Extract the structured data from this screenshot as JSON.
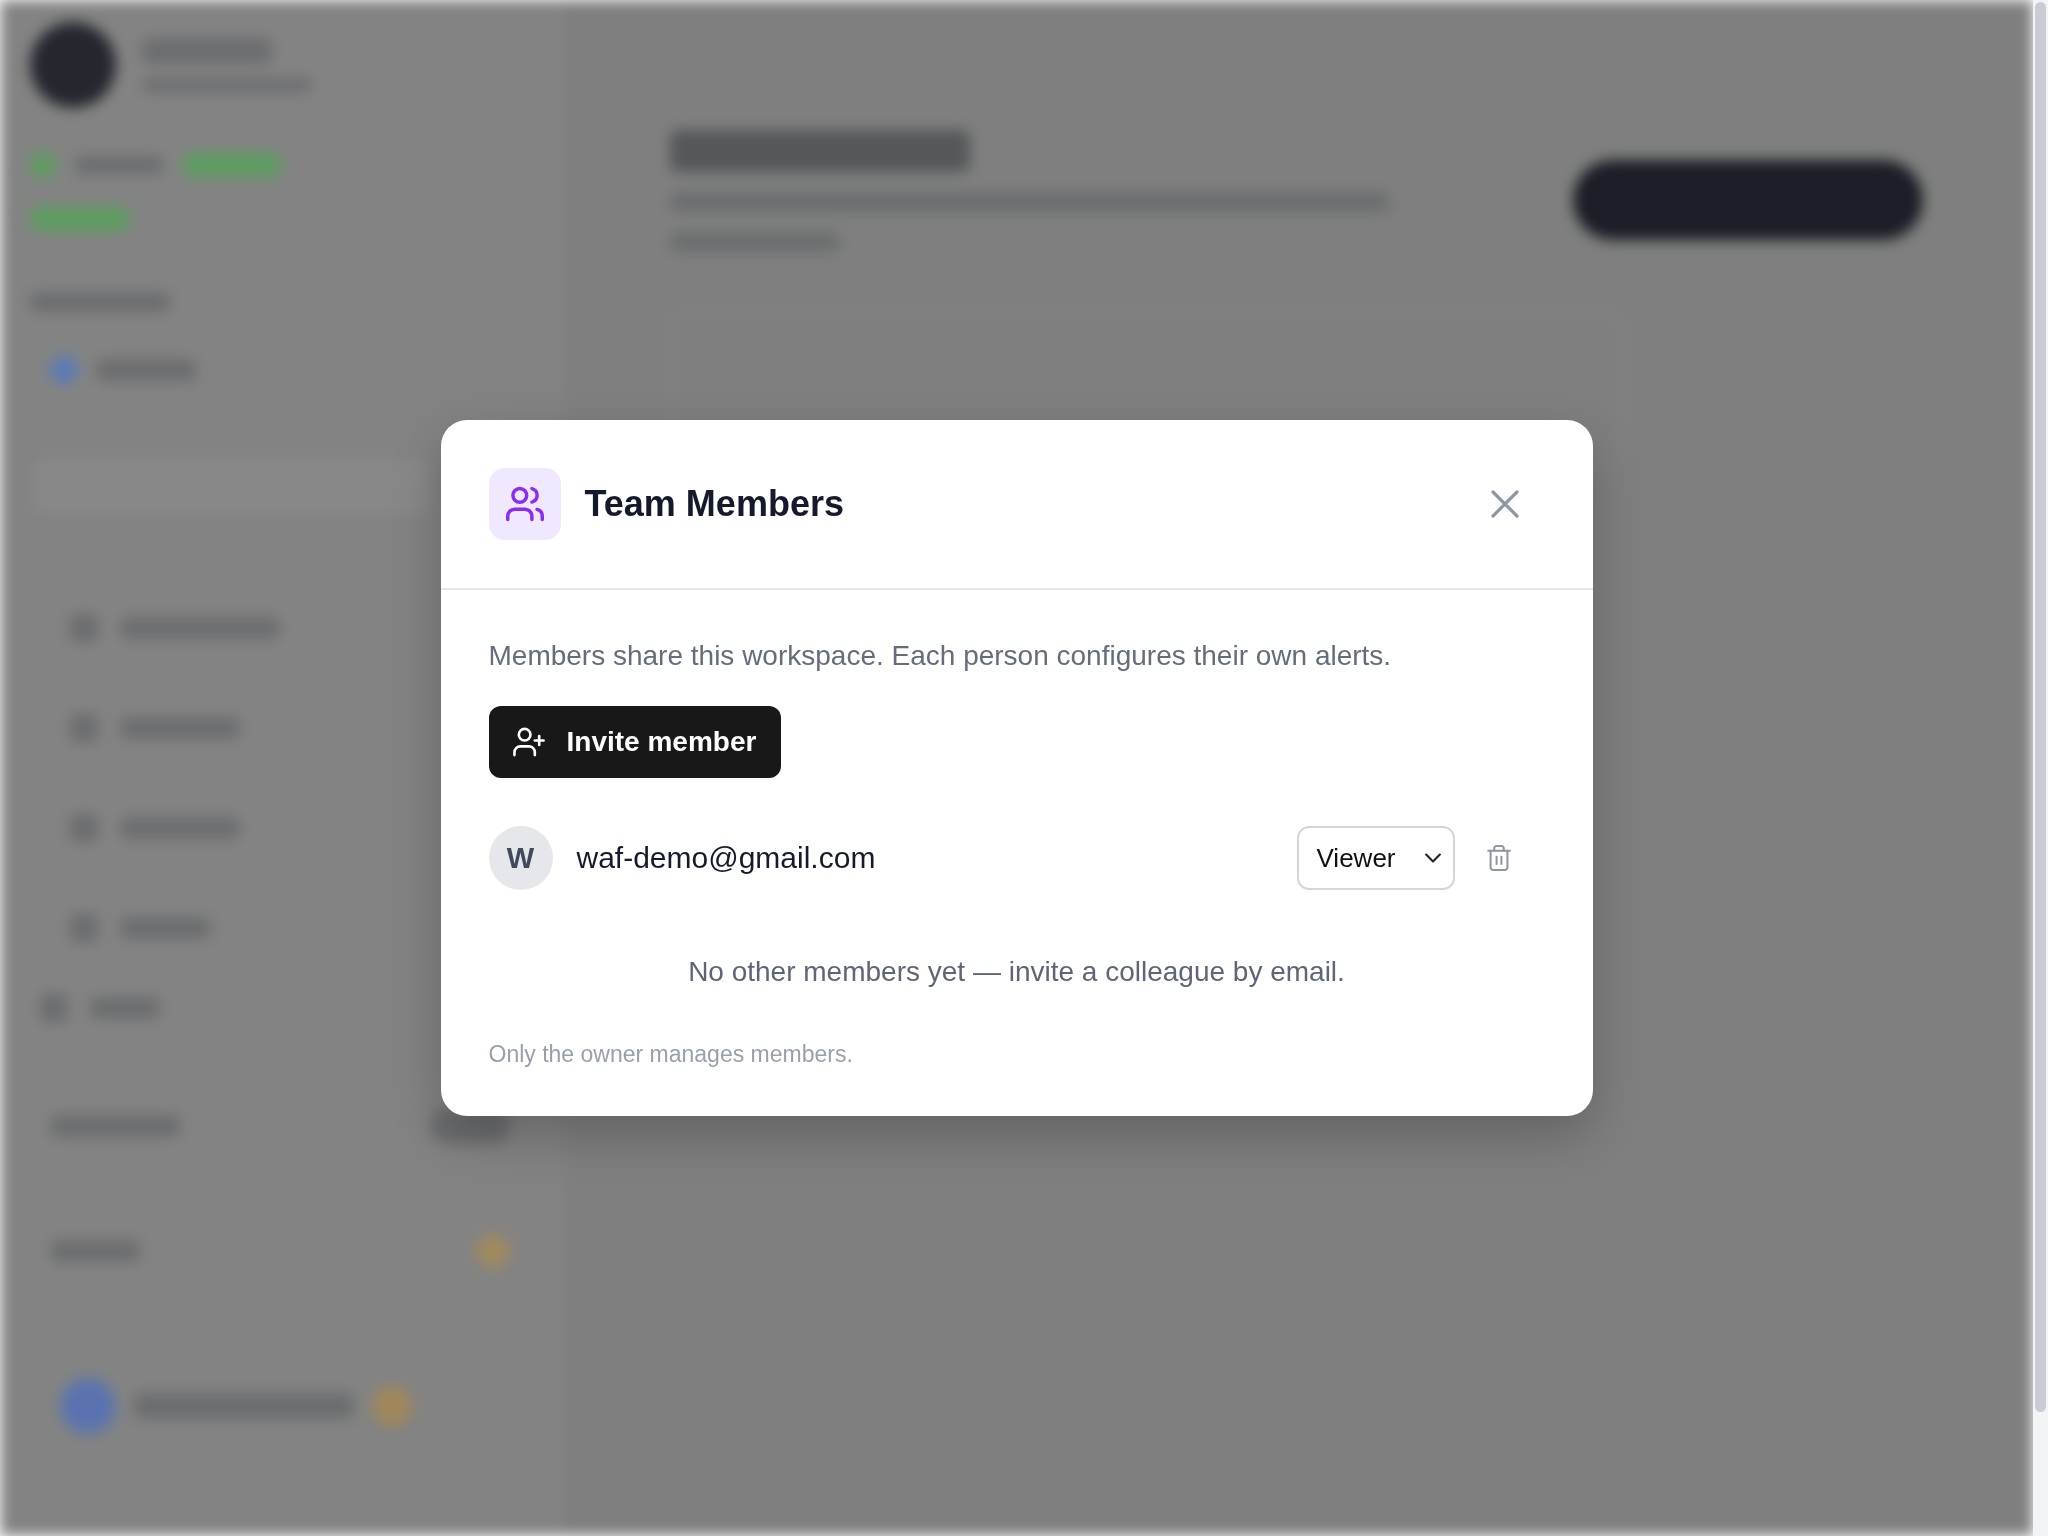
{
  "dialog": {
    "title": "Team Members",
    "description": "Members share this workspace. Each person configures their own alerts.",
    "invite_button": {
      "label": "Invite member"
    },
    "members": [
      {
        "initial": "W",
        "email": "waf-demo@gmail.com",
        "role": "Viewer"
      }
    ],
    "empty_message": "No other members yet — invite a colleague by email.",
    "footnote": "Only the owner manages members."
  }
}
